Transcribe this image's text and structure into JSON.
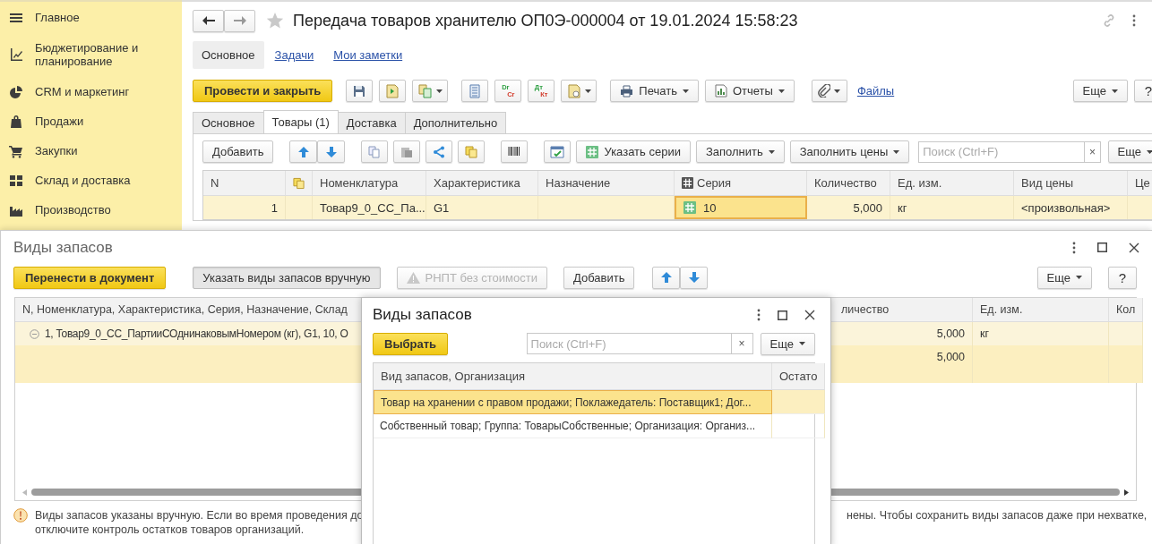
{
  "sidebar": {
    "items": [
      {
        "label": "Главное"
      },
      {
        "label": "Бюджетирование и планирование"
      },
      {
        "label": "CRM и маркетинг"
      },
      {
        "label": "Продажи"
      },
      {
        "label": "Закупки"
      },
      {
        "label": "Склад и доставка"
      },
      {
        "label": "Производство"
      }
    ]
  },
  "document": {
    "title": "Передача товаров хранителю ОП0Э-000004 от 19.01.2024 15:58:23",
    "nav_tabs": [
      {
        "label": "Основное",
        "selected": true
      },
      {
        "label": "Задачи",
        "selected": false
      },
      {
        "label": "Мои заметки",
        "selected": false
      }
    ],
    "commands": {
      "post_and_close": "Провести и закрыть",
      "debit_credit": [
        "Dr",
        "Cr"
      ],
      "dt_kt": [
        "Дт",
        "Кт"
      ],
      "print": "Печать",
      "reports": "Отчеты",
      "files": "Файлы",
      "more": "Еще",
      "help": "?"
    },
    "tabs": [
      {
        "label": "Основное",
        "selected": false
      },
      {
        "label": "Товары (1)",
        "selected": true
      },
      {
        "label": "Доставка",
        "selected": false
      },
      {
        "label": "Дополнительно",
        "selected": false
      }
    ],
    "table_toolbar": {
      "add": "Добавить",
      "set_series": "Указать серии",
      "fill": "Заполнить",
      "fill_prices": "Заполнить цены",
      "search_placeholder": "Поиск (Ctrl+F)",
      "clear": "×",
      "more": "Еще"
    },
    "table": {
      "columns": [
        "N",
        "Номенклатура",
        "Характеристика",
        "Назначение",
        "Серия",
        "Количество",
        "Ед. изм.",
        "Вид цены",
        "Це"
      ],
      "rows": [
        {
          "n": "1",
          "nomenclature": "Товар9_0_СС_Па...",
          "characteristic": "G1",
          "series": "10",
          "quantity": "5,000",
          "unit": "кг",
          "price_kind": "<произвольная>",
          "selected": true,
          "series_focused": true
        }
      ]
    }
  },
  "stock_dialog": {
    "title": "Виды запасов",
    "buttons": {
      "transfer": {
        "label": "Перенести в документ"
      },
      "manual": {
        "label": "Указать виды запасов вручную",
        "pressed": true
      },
      "rnpt": {
        "label": "РНПТ без стоимости",
        "disabled": true
      },
      "add": {
        "label": "Добавить"
      },
      "more": {
        "label": "Еще"
      },
      "help": {
        "label": "?"
      }
    },
    "columns": [
      "N, Номенклатура, Характеристика, Серия, Назначение, Склад",
      "личество",
      "Ед. изм.",
      "Кол"
    ],
    "rows": [
      {
        "kind": "group",
        "expanded": true,
        "text": "1, Товар9_0_СС_ПартииСОднинаковымНомером (кг), G1, 10, О",
        "quantity": "5,000",
        "unit": "кг",
        "selected": false
      },
      {
        "kind": "detail",
        "quantity": "5,000",
        "selected": true
      }
    ],
    "message": {
      "line1_left": "Виды запасов указаны вручную. Если во время проведения до",
      "line1_right": "нены. Чтобы сохранить виды запасов даже при нехватке,",
      "line2": "отключите контроль остатков товаров организаций."
    }
  },
  "picker_dialog": {
    "title": "Виды запасов",
    "select": "Выбрать",
    "search_placeholder": "Поиск (Ctrl+F)",
    "clear": "×",
    "more": "Еще",
    "columns": [
      "Вид запасов, Организация",
      "Остато"
    ],
    "rows": [
      {
        "text": "Товар на хранении с правом продажи; Поклажедатель: Поставщик1; Дог...",
        "selected": true
      },
      {
        "text": "Собственный товар; Группа: ТоварыСобственные; Организация: Организ...",
        "selected": false
      }
    ]
  }
}
